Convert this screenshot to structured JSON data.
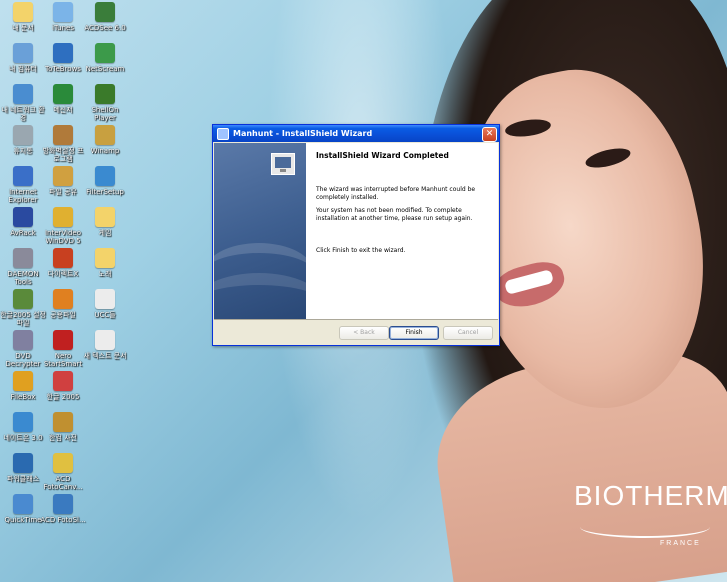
{
  "wallpaper": {
    "brand_name": "BIOTHERM",
    "brand_sub": "FRANCE"
  },
  "desktop_icons": [
    {
      "label": "내 문서",
      "color": "#f3d36a"
    },
    {
      "label": "iTunes",
      "color": "#7bb4e8"
    },
    {
      "label": "ACDSee 6.0",
      "color": "#3a7d3a"
    },
    {
      "label": "내 컴퓨터",
      "color": "#6aa0d8"
    },
    {
      "label": "ToTeBrows",
      "color": "#2e6fc0"
    },
    {
      "label": "NetScream",
      "color": "#3c9a4a"
    },
    {
      "label": "내 네트워크 환경",
      "color": "#4a8dd0"
    },
    {
      "label": "메신저",
      "color": "#2a8a3a"
    },
    {
      "label": "ShellOn Player",
      "color": "#3a7a2a"
    },
    {
      "label": "휴지통",
      "color": "#9aa7b0"
    },
    {
      "label": "방화벽설정 프로그램",
      "color": "#b07a3a"
    },
    {
      "label": "Winamp",
      "color": "#c8a040"
    },
    {
      "label": "Internet Explorer",
      "color": "#3a6fc8"
    },
    {
      "label": "파일 공유",
      "color": "#d0a040"
    },
    {
      "label": "FilterSetup",
      "color": "#3a8ad0"
    },
    {
      "label": "AvRack",
      "color": "#2a4aa0"
    },
    {
      "label": "InterVideo WinDVD 5",
      "color": "#e0b030"
    },
    {
      "label": "게임",
      "color": "#f3d36a"
    },
    {
      "label": "DAEMON Tools",
      "color": "#8a8a9a"
    },
    {
      "label": "다이렉트X",
      "color": "#c84020"
    },
    {
      "label": "노래",
      "color": "#f3d36a"
    },
    {
      "label": "한글2005 설정파일",
      "color": "#5a8a3a"
    },
    {
      "label": "공용파일",
      "color": "#e08020"
    },
    {
      "label": "UCC들",
      "color": "#ececec"
    },
    {
      "label": "DVD Decrypter",
      "color": "#8080a0"
    },
    {
      "label": "Nero StartSmart",
      "color": "#c02020"
    },
    {
      "label": "새 텍스트 문서",
      "color": "#ececec"
    },
    {
      "label": "FileBox",
      "color": "#e0a020"
    },
    {
      "label": "한글 2005",
      "color": "#d04040"
    },
    {
      "label": "네이트온 3.0",
      "color": "#3a8ad0"
    },
    {
      "label": "한컴 사전",
      "color": "#c09030"
    },
    {
      "label": "파워클래스",
      "color": "#2a6ab0"
    },
    {
      "label": "ACD FotoCanv...",
      "color": "#e0c040"
    },
    {
      "label": "QuickTime",
      "color": "#4a8ad0"
    },
    {
      "label": "ACD FotoSl...",
      "color": "#3a7ac0"
    }
  ],
  "dialog": {
    "title": "Manhunt - InstallShield Wizard",
    "close_glyph": "✕",
    "heading": "InstallShield Wizard Completed",
    "para1": "The wizard was interrupted before Manhunt could be completely installed.",
    "para2": "Your system has not been modified. To complete installation at another time, please run setup again.",
    "para3": "Click Finish to exit the wizard.",
    "back_label": "< Back",
    "finish_label": "Finish",
    "cancel_label": "Cancel"
  }
}
